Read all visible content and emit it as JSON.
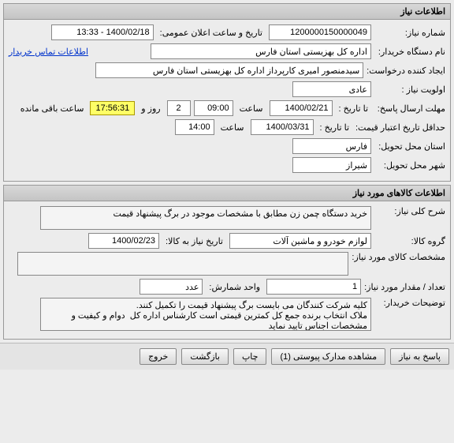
{
  "panel1": {
    "title": "اطلاعات نیاز",
    "need_no_label": "شماره نیاز:",
    "need_no": "1200000150000049",
    "pub_dt_label": "تاریخ و ساعت اعلان عمومی:",
    "pub_dt": "1400/02/18 - 13:33",
    "org_label": "نام دستگاه خریدار:",
    "org": "اداره کل بهزیستی استان فارس",
    "contact_link": "اطلاعات تماس خریدار",
    "requester_label": "ایجاد کننده درخواست:",
    "requester": "سیدمنصور امیری کارپرداز اداره کل بهزیستی استان فارس",
    "priority_label": "اولویت نیاز :",
    "priority": "عادی",
    "deadline_label": "مهلت ارسال پاسخ:",
    "to_date_label": "تا تاریخ :",
    "deadline_date": "1400/02/21",
    "time_label": "ساعت",
    "deadline_time": "09:00",
    "days": "2",
    "days_label": "روز و",
    "countdown": "17:56:31",
    "remain_label": "ساعت باقی مانده",
    "min_credit_label": "حداقل تاریخ اعتبار قیمت:",
    "min_credit_to": "تا تاریخ :",
    "min_credit_date": "1400/03/31",
    "min_credit_time": "14:00",
    "province_label": "استان محل تحویل:",
    "province": "فارس",
    "city_label": "شهر محل تحویل:",
    "city": "شیراز"
  },
  "panel2": {
    "title": "اطلاعات کالاهای مورد نیاز",
    "desc_label": "شرح کلی نیاز:",
    "desc": "خرید دستگاه چمن زن مطابق با مشخصات موجود در برگ پیشنهاد قیمت",
    "group_label": "گروه کالا:",
    "group": "لوازم خودرو و ماشین آلات",
    "need_date_label": "تاریخ نیاز به کالا:",
    "need_date": "1400/02/23",
    "spec_label": "مشخصات کالای مورد نیاز:",
    "spec": "",
    "qty_label": "تعداد / مقدار مورد نیاز:",
    "qty": "1",
    "unit_label": "واحد شمارش:",
    "unit": "عدد",
    "notes_label": "توضیحات خریدار:",
    "notes": "کلیه شرکت کنندگان می بایست برگ پیشنهاد قیمت را تکمیل کنند.\nملاک انتخاب برنده جمع کل کمترین قیمتی است کارشناس اداره کل  دوام و کیفیت و مشخصات اجناس تایید نماید\nهزینه حمل ونقل تا تحویل به بهزیستی به عهده فروشنده میباشد."
  },
  "buttons": {
    "reply": "پاسخ به نیاز",
    "attach": "مشاهده مدارک پیوستی (1)",
    "print": "چاپ",
    "back": "بازگشت",
    "exit": "خروج"
  }
}
